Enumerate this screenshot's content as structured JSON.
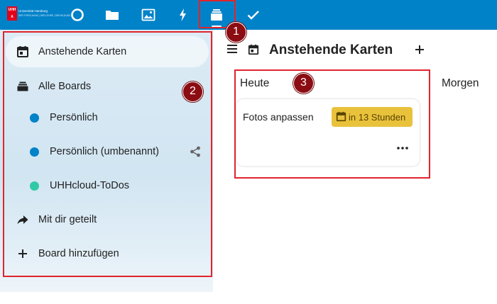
{
  "topbar": {
    "logo": {
      "mark_top": "UHH",
      "mark_bottom": "A",
      "name": "Universität Hamburg",
      "tagline": "DER FORSCHUNG | DER LEHRE | DER BILDUNG"
    },
    "apps": [
      {
        "name": "Dashboard",
        "icon": "circle-icon"
      },
      {
        "name": "Files",
        "icon": "folder-icon"
      },
      {
        "name": "Photos",
        "icon": "image-icon"
      },
      {
        "name": "Activity",
        "icon": "lightning-icon"
      },
      {
        "name": "Deck",
        "icon": "deck-icon",
        "active": true
      },
      {
        "name": "Tasks",
        "icon": "checkmark-icon"
      }
    ],
    "background": "#0082c9"
  },
  "annotations": {
    "badge1": "1",
    "badge2": "2",
    "badge3": "3",
    "color": "#e0252c"
  },
  "sidebar": {
    "items": [
      {
        "label": "Anstehende Karten",
        "icon": "calendar-icon",
        "active": true
      },
      {
        "label": "Alle Boards",
        "icon": "stack-icon"
      },
      {
        "label": "Persönlich",
        "color": "#0082c9"
      },
      {
        "label": "Persönlich (umbenannt)",
        "color": "#0082c9",
        "shared": true
      },
      {
        "label": "UHHcloud-ToDos",
        "color": "#30c9a6"
      },
      {
        "label": "Mit dir geteilt",
        "icon": "share-arrow-icon"
      },
      {
        "label": "Board hinzufügen",
        "icon": "plus-icon"
      }
    ]
  },
  "main": {
    "title": "Anstehende Karten",
    "columns": [
      {
        "title": "Heute"
      },
      {
        "title": "Morgen"
      }
    ],
    "card": {
      "title": "Fotos anpassen",
      "due": "in 13 Stunden",
      "due_color": "#e9c23c"
    }
  }
}
